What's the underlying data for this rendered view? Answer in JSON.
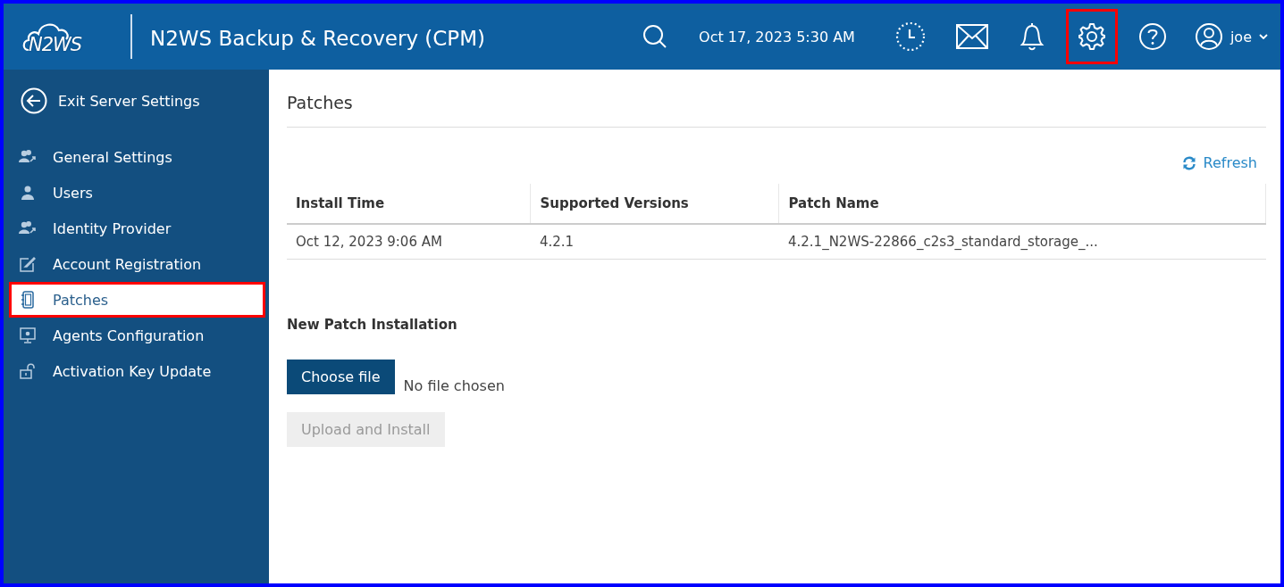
{
  "header": {
    "logo_text": "N2WS",
    "title": "N2WS Backup & Recovery (CPM)",
    "datetime": "Oct 17, 2023 5:30 AM",
    "icons": [
      {
        "kind": "clock",
        "highlighted": false
      },
      {
        "kind": "mail",
        "highlighted": false
      },
      {
        "kind": "bell",
        "highlighted": false
      },
      {
        "kind": "gear",
        "highlighted": true
      },
      {
        "kind": "help",
        "highlighted": false
      }
    ],
    "user": "joe"
  },
  "sidebar": {
    "back_label": "Exit Server Settings",
    "items": [
      {
        "label": "General Settings",
        "kind": "users",
        "selected": false,
        "highlighted": false
      },
      {
        "label": "Users",
        "kind": "user",
        "selected": false,
        "highlighted": false
      },
      {
        "label": "Identity Provider",
        "kind": "users",
        "selected": false,
        "highlighted": false
      },
      {
        "label": "Account Registration",
        "kind": "edit",
        "selected": false,
        "highlighted": false
      },
      {
        "label": "Patches",
        "kind": "patch",
        "selected": true,
        "highlighted": true
      },
      {
        "label": "Agents Configuration",
        "kind": "monitor",
        "selected": false,
        "highlighted": false
      },
      {
        "label": "Activation Key Update",
        "kind": "lock",
        "selected": false,
        "highlighted": false
      }
    ]
  },
  "page": {
    "title": "Patches",
    "refresh": "Refresh",
    "table": {
      "columns": [
        "Install Time",
        "Supported Versions",
        "Patch Name"
      ],
      "rows": [
        [
          "Oct 12, 2023 9:06 AM",
          "4.2.1",
          "4.2.1_N2WS-22866_c2s3_standard_storage_..."
        ]
      ]
    },
    "new_patch": {
      "heading": "New Patch Installation",
      "choose_button": "Choose file",
      "file_status": "No file chosen",
      "upload_button": {
        "label": "Upload and Install",
        "disabled": true
      }
    }
  }
}
